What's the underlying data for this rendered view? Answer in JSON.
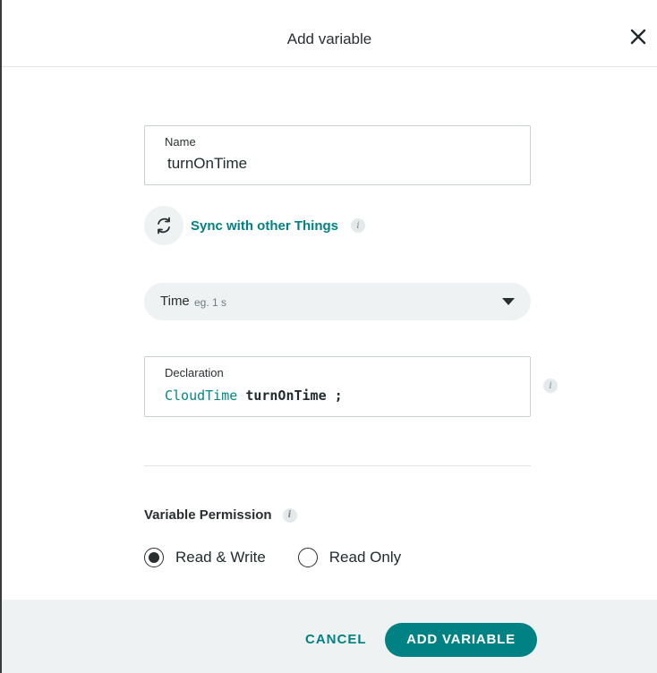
{
  "dialog": {
    "title": "Add variable",
    "close_icon": "close-icon"
  },
  "name_field": {
    "label": "Name",
    "value": "turnOnTime"
  },
  "sync": {
    "icon": "sync-icon",
    "label": "Sync with other Things",
    "info_icon": "info-icon"
  },
  "type_select": {
    "value": "Time",
    "hint": "eg. 1 s",
    "caret_icon": "chevron-down-icon"
  },
  "declaration": {
    "label": "Declaration",
    "type": "CloudTime",
    "name": "turnOnTime",
    "terminator": ";",
    "info_icon": "info-icon"
  },
  "permission": {
    "title": "Variable Permission",
    "info_icon": "info-icon",
    "options": [
      {
        "label": "Read & Write",
        "selected": true
      },
      {
        "label": "Read Only",
        "selected": false
      }
    ]
  },
  "footer": {
    "cancel_label": "CANCEL",
    "add_label": "ADD VARIABLE"
  },
  "colors": {
    "accent": "#008184",
    "panel_bg": "#eef2f3"
  }
}
